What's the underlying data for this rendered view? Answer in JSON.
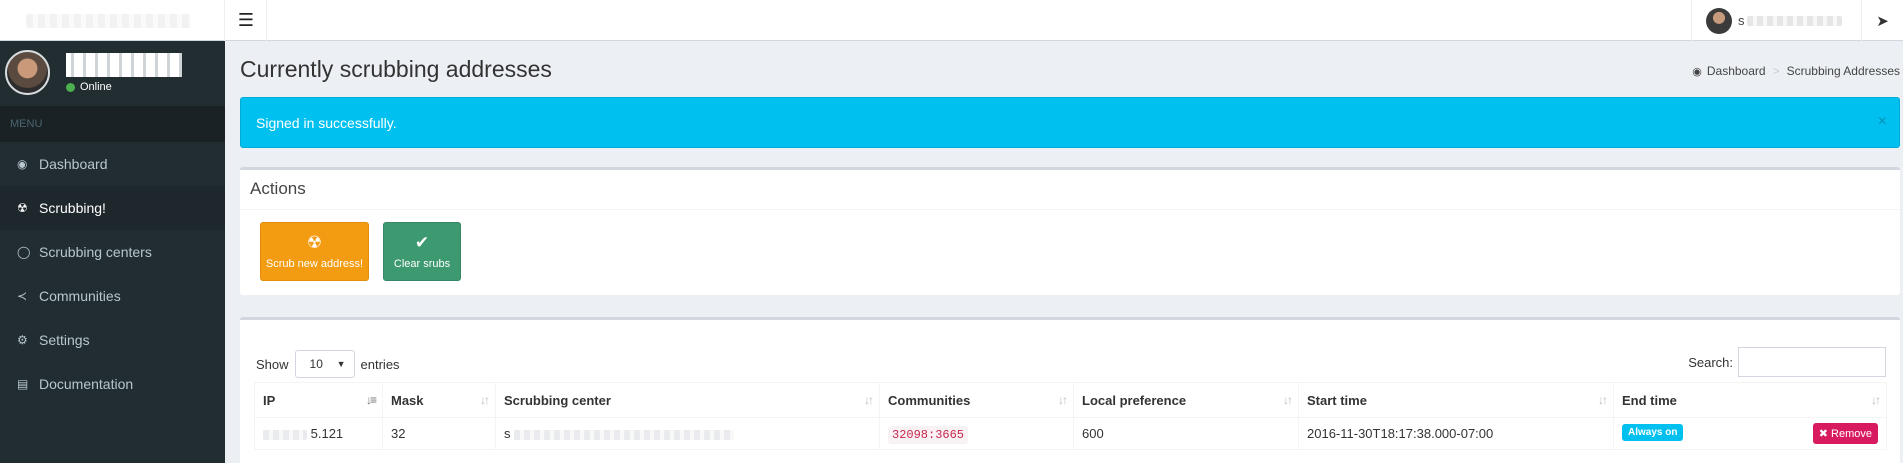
{
  "header": {
    "logo_alt": "",
    "toggle_icon": "menu-icon",
    "user_initial": "s",
    "send_icon": "paper-plane-icon"
  },
  "sidebar": {
    "status": "Online",
    "menu_header": "MENU",
    "items": [
      {
        "label": "Dashboard",
        "icon": "dashboard-icon"
      },
      {
        "label": "Scrubbing!",
        "icon": "radiation-icon"
      },
      {
        "label": "Scrubbing centers",
        "icon": "globe-icon"
      },
      {
        "label": "Communities",
        "icon": "share-icon"
      },
      {
        "label": "Settings",
        "icon": "gears-icon"
      },
      {
        "label": "Documentation",
        "icon": "book-icon"
      }
    ]
  },
  "page": {
    "title": "Currently scrubbing addresses",
    "breadcrumb": [
      "Dashboard",
      "Scrubbing Addresses"
    ]
  },
  "alert": {
    "message": "Signed in successfully.",
    "close": "×"
  },
  "actions": {
    "title": "Actions",
    "scrub_label": "Scrub new address!",
    "clear_label": "Clear srubs"
  },
  "table": {
    "show_label": "Show",
    "entries_label": "entries",
    "page_length": "10",
    "search_label": "Search:",
    "columns": [
      "IP",
      "Mask",
      "Scrubbing center",
      "Communities",
      "Local preference",
      "Start time",
      "End time"
    ],
    "rows": [
      {
        "ip_suffix": "5.121",
        "mask": "32",
        "center_prefix": "s",
        "communities": "32098:3665",
        "local_pref": "600",
        "start_time": "2016-11-30T18:17:38.000-07:00",
        "end_time": "Always on",
        "remove": "Remove"
      }
    ]
  },
  "colors": {
    "sidebar_bg": "#222d32",
    "alert_bg": "#00c0ef",
    "scrub_button": "#f39c12",
    "clear_button": "#3d9970",
    "remove_button": "#d81b60"
  }
}
